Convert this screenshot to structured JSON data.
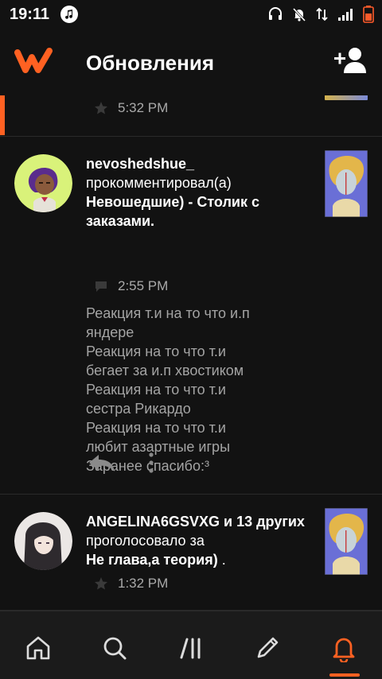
{
  "status_bar": {
    "time": "19:11"
  },
  "app_bar": {
    "title": "Обновления"
  },
  "feed": {
    "top_partial": {
      "time": "5:32 PM"
    },
    "items": [
      {
        "username": "nevoshedshue_",
        "action": "прокомментировал(а)",
        "story": "Невошедшие) - Столик с заказами.",
        "time": "2:55 PM",
        "comment_lines": [
          "Реакция т.и на то что и.п",
          "яндере",
          "Реакция на то что т.и",
          "бегает за и.п хвостиком",
          "Реакция на то что т.и",
          "сестра Рикардо",
          "Реакция на то что т.и",
          "любит азартные игры",
          "Заранее спасибо:³"
        ]
      },
      {
        "username": "ANGELINA6GSVXG",
        "and_others": "и 13 других",
        "action": "проголосовало за",
        "story": "Не глава,а теория)",
        "trail": ".",
        "time": "1:32 PM"
      }
    ]
  },
  "bottom_nav": {
    "items": [
      "home-icon",
      "search-icon",
      "library-icon",
      "write-icon",
      "notifications-icon"
    ],
    "active": "notifications-icon"
  },
  "colors": {
    "accent": "#ff6122",
    "background": "#121212",
    "secondary_text": "#a4a4a4"
  }
}
